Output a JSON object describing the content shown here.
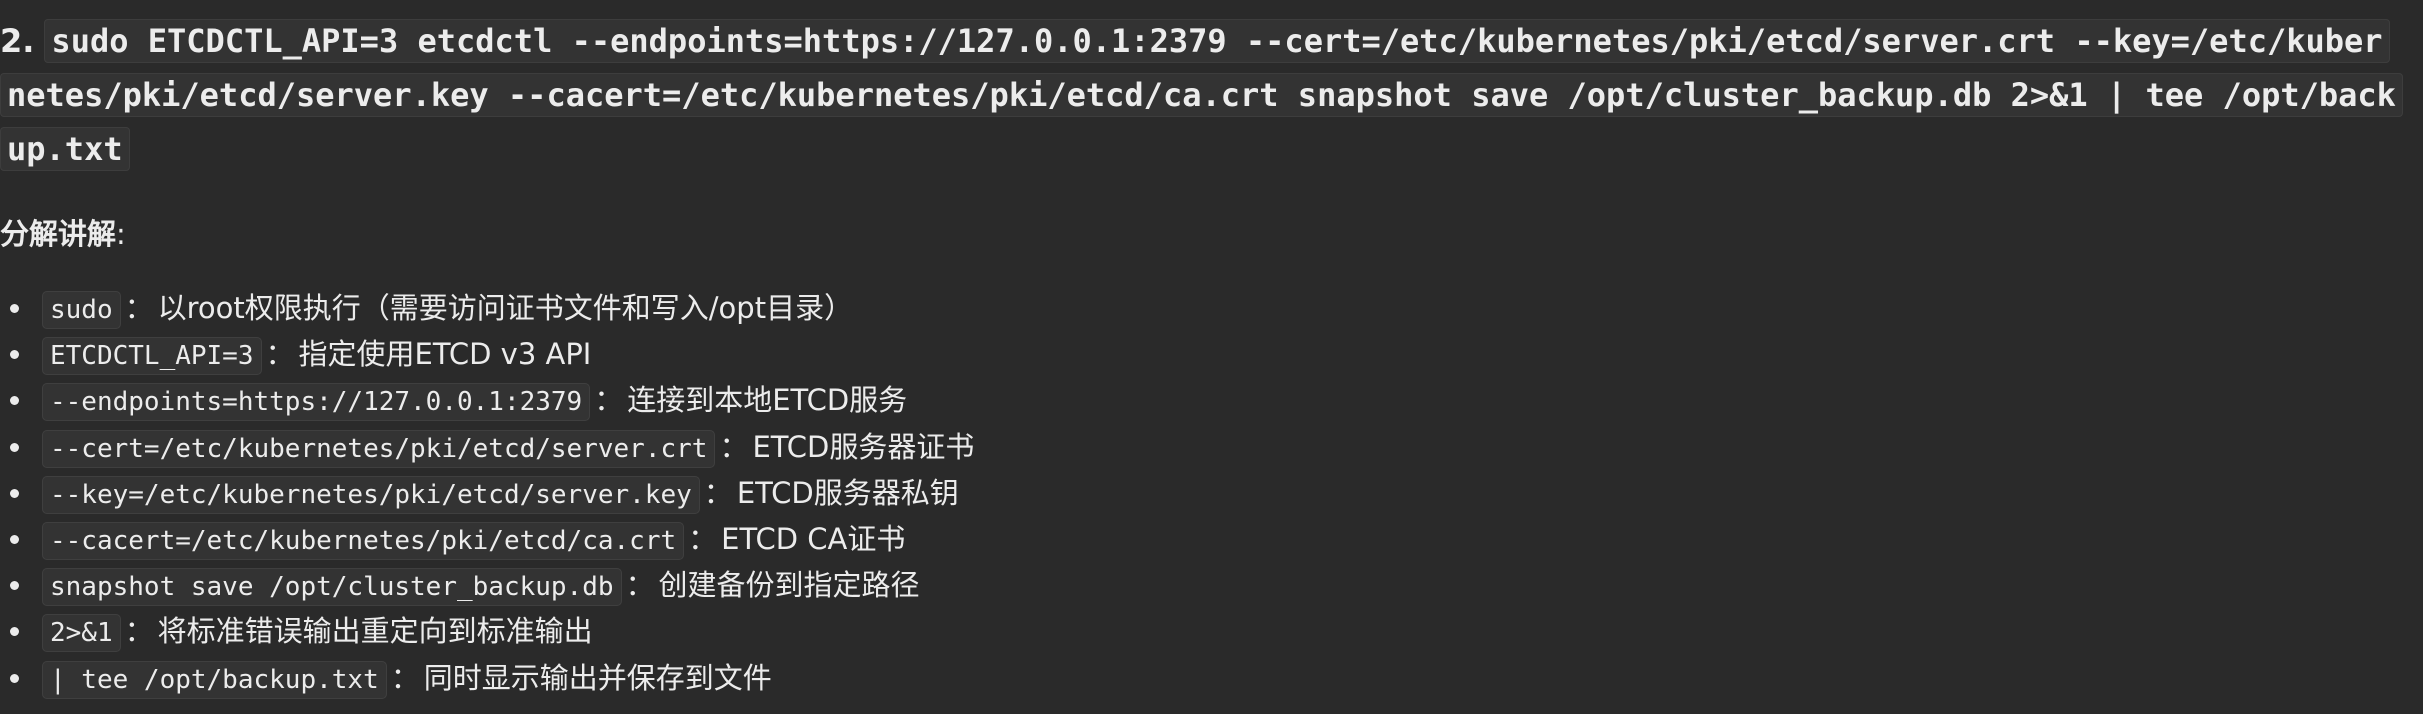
{
  "heading": {
    "number": "2.",
    "command": "sudo ETCDCTL_API=3 etcdctl --endpoints=https://127.0.0.1:2379 --cert=/etc/kubernetes/pki/etcd/server.crt --key=/etc/kubernetes/pki/etcd/server.key --cacert=/etc/kubernetes/pki/etcd/ca.crt snapshot save /opt/cluster_backup.db 2>&1 | tee /opt/backup.txt"
  },
  "breakdown": {
    "title": "分解讲解",
    "colon": ":"
  },
  "items": [
    {
      "code": "sudo",
      "sep": "：",
      "desc": "以root权限执行（需要访问证书文件和写入/opt目录）"
    },
    {
      "code": "ETCDCTL_API=3",
      "sep": "：",
      "desc": "指定使用ETCD v3 API"
    },
    {
      "code": "--endpoints=https://127.0.0.1:2379",
      "sep": "：",
      "desc": "连接到本地ETCD服务"
    },
    {
      "code": "--cert=/etc/kubernetes/pki/etcd/server.crt",
      "sep": "：",
      "desc": "ETCD服务器证书"
    },
    {
      "code": "--key=/etc/kubernetes/pki/etcd/server.key",
      "sep": "：",
      "desc": "ETCD服务器私钥"
    },
    {
      "code": "--cacert=/etc/kubernetes/pki/etcd/ca.crt",
      "sep": "：",
      "desc": "ETCD CA证书"
    },
    {
      "code": "snapshot save /opt/cluster_backup.db",
      "sep": "：",
      "desc": "创建备份到指定路径"
    },
    {
      "code": "2>&1",
      "sep": "：",
      "desc": "将标准错误输出重定向到标准输出"
    },
    {
      "code": "| tee /opt/backup.txt",
      "sep": "：",
      "desc": "同时显示输出并保存到文件"
    }
  ]
}
